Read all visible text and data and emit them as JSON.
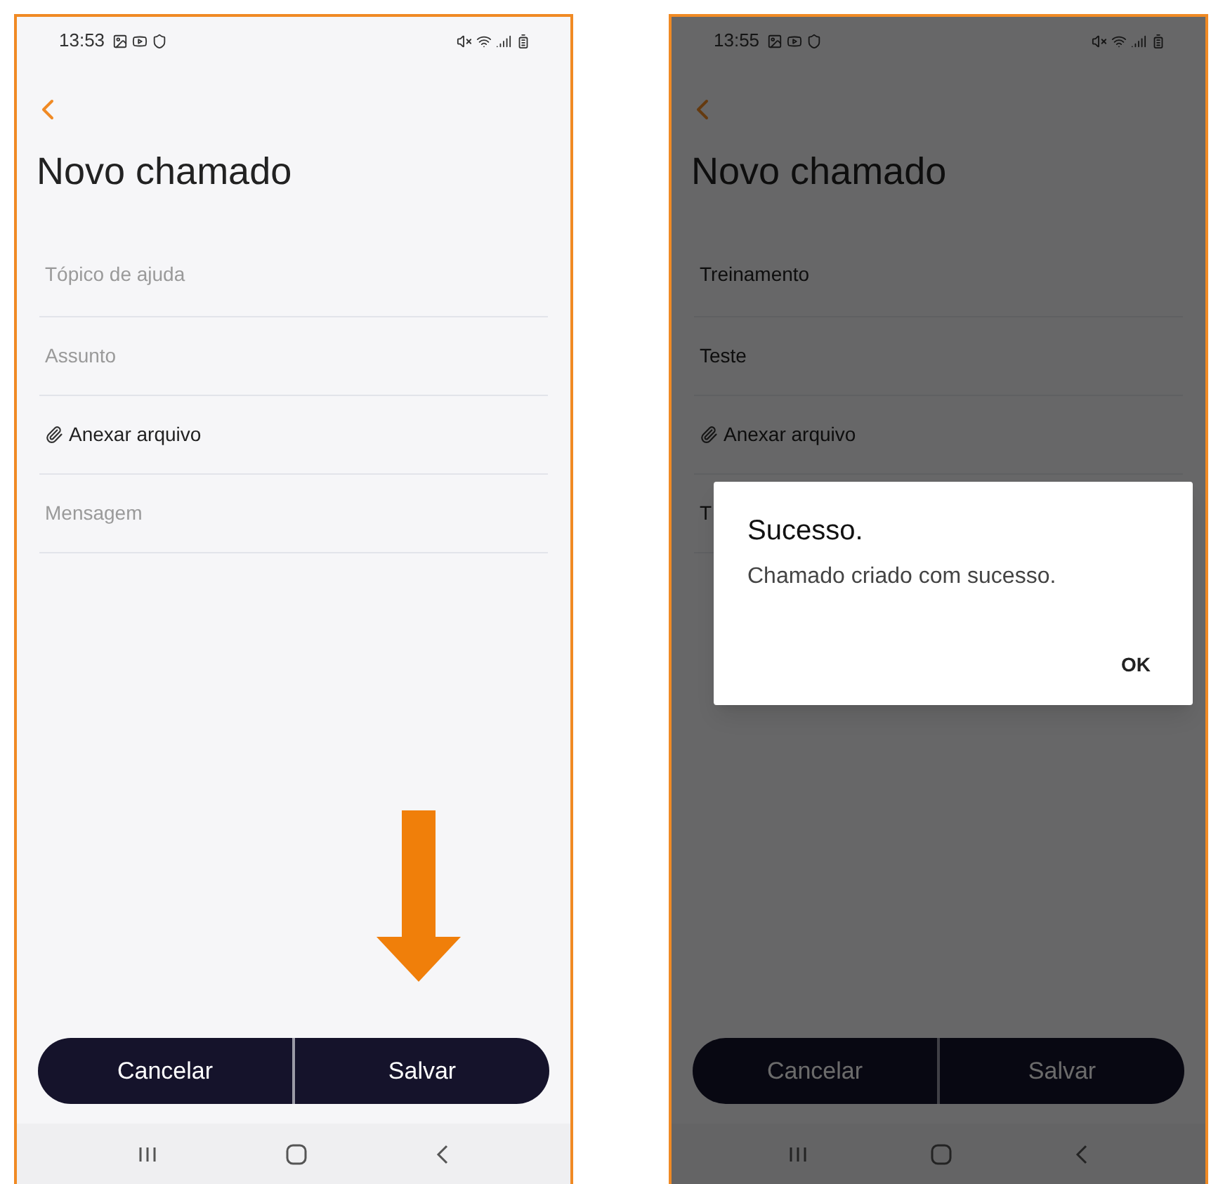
{
  "phones": [
    {
      "status_bar": {
        "time": "13:53"
      },
      "title": "Novo chamado",
      "fields": [
        {
          "kind": "text",
          "placeholder": "Tópico de ajuda"
        },
        {
          "kind": "text",
          "placeholder": "Assunto"
        },
        {
          "kind": "attach",
          "label": "Anexar arquivo"
        },
        {
          "kind": "text",
          "placeholder": "Mensagem"
        }
      ],
      "annotation": {
        "kind": "down_arrow"
      },
      "buttons": [
        "Cancelar",
        "Salvar"
      ]
    },
    {
      "status_bar": {
        "time": "13:55"
      },
      "title": "Novo chamado",
      "fields": [
        {
          "kind": "text",
          "value": "Treinamento"
        },
        {
          "kind": "text",
          "value": "Teste"
        },
        {
          "kind": "attach",
          "label": "Anexar arquivo"
        },
        {
          "kind": "text",
          "value": "T"
        }
      ],
      "buttons": [
        "Cancelar",
        "Salvar"
      ],
      "dialog": {
        "title": "Sucesso.",
        "message": "Chamado criado com sucesso.",
        "button": "OK"
      }
    }
  ]
}
